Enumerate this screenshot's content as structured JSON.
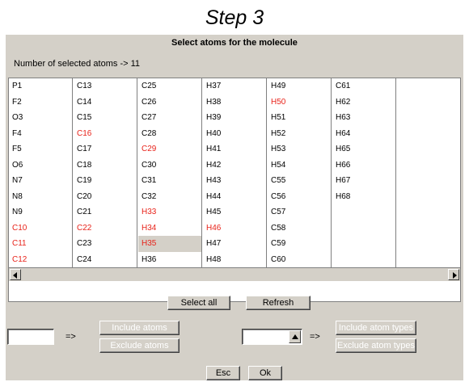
{
  "step_title": "Step 3",
  "dialog": {
    "title": "Select atoms for the molecule",
    "count_label": "Number of selected atoms -> 11"
  },
  "columns": [
    [
      {
        "t": "P1"
      },
      {
        "t": "F2"
      },
      {
        "t": "O3"
      },
      {
        "t": "F4"
      },
      {
        "t": "F5"
      },
      {
        "t": "O6"
      },
      {
        "t": "N7"
      },
      {
        "t": "N8"
      },
      {
        "t": "N9"
      },
      {
        "t": "C10",
        "red": true
      },
      {
        "t": "C11",
        "red": true
      },
      {
        "t": "C12",
        "red": true
      }
    ],
    [
      {
        "t": "C13"
      },
      {
        "t": "C14"
      },
      {
        "t": "C15"
      },
      {
        "t": "C16",
        "red": true
      },
      {
        "t": "C17"
      },
      {
        "t": "C18"
      },
      {
        "t": "C19"
      },
      {
        "t": "C20"
      },
      {
        "t": "C21"
      },
      {
        "t": "C22",
        "red": true
      },
      {
        "t": "C23"
      },
      {
        "t": "C24"
      }
    ],
    [
      {
        "t": "C25"
      },
      {
        "t": "C26"
      },
      {
        "t": "C27"
      },
      {
        "t": "C28"
      },
      {
        "t": "C29",
        "red": true
      },
      {
        "t": "C30"
      },
      {
        "t": "C31"
      },
      {
        "t": "C32"
      },
      {
        "t": "H33",
        "red": true
      },
      {
        "t": "H34",
        "red": true
      },
      {
        "t": "H35",
        "red": true,
        "sel": true
      },
      {
        "t": "H36"
      }
    ],
    [
      {
        "t": "H37"
      },
      {
        "t": "H38"
      },
      {
        "t": "H39"
      },
      {
        "t": "H40"
      },
      {
        "t": "H41"
      },
      {
        "t": "H42"
      },
      {
        "t": "H43"
      },
      {
        "t": "H44"
      },
      {
        "t": "H45"
      },
      {
        "t": "H46",
        "red": true
      },
      {
        "t": "H47"
      },
      {
        "t": "H48"
      }
    ],
    [
      {
        "t": "H49"
      },
      {
        "t": "H50",
        "red": true
      },
      {
        "t": "H51"
      },
      {
        "t": "H52"
      },
      {
        "t": "H53"
      },
      {
        "t": "H54"
      },
      {
        "t": "C55"
      },
      {
        "t": "C56"
      },
      {
        "t": "C57"
      },
      {
        "t": "C58"
      },
      {
        "t": "C59"
      },
      {
        "t": "C60"
      }
    ],
    [
      {
        "t": "C61"
      },
      {
        "t": "H62"
      },
      {
        "t": "H63"
      },
      {
        "t": "H64"
      },
      {
        "t": "H65"
      },
      {
        "t": "H66"
      },
      {
        "t": "H67"
      },
      {
        "t": "H68"
      }
    ],
    []
  ],
  "buttons": {
    "select_all": "Select all",
    "refresh": "Refresh",
    "include_atoms": "Include atoms",
    "exclude_atoms": "Exclude atoms",
    "include_atom_types": "Include atom types",
    "exclude_atom_types": "Exclude atom types",
    "esc": "Esc",
    "ok": "Ok"
  },
  "arrow_symbol": "=>",
  "inputs": {
    "atoms_value": "",
    "atom_type_value": ""
  },
  "colors": {
    "dialog_bg": "#d4d0c8",
    "highlight_text": "#e8231a"
  }
}
